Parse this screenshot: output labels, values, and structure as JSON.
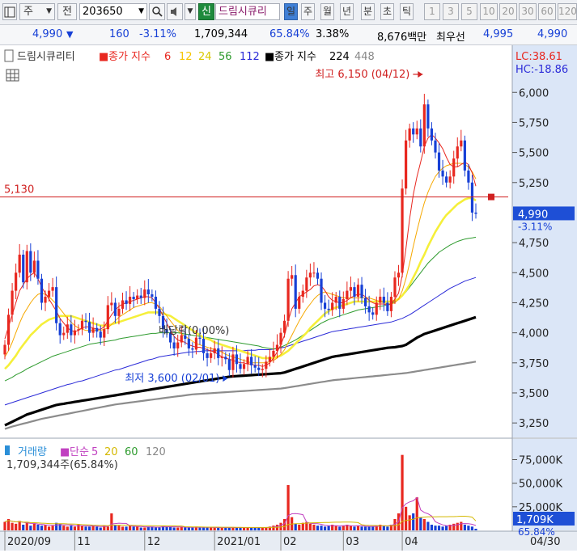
{
  "toolbar": {
    "menu_icon": "panel-icon",
    "market_label": "주",
    "prefix_label": "전",
    "code_value": "203650",
    "new_badge": "신",
    "stock_name": "드림시큐리",
    "periods": [
      "일",
      "주",
      "월",
      "년",
      "분",
      "초",
      "틱"
    ],
    "selected_period": "일",
    "numbers": [
      "1",
      "3",
      "5",
      "10",
      "20",
      "30",
      "60",
      "120"
    ]
  },
  "quote": {
    "price": "4,990",
    "change_arrow": "▼",
    "change": "160",
    "change_pct": "-3.11%",
    "volume": "1,709,344",
    "vol_ratio": "65.84%",
    "turnover": "3.38%",
    "amount": "8,676백만",
    "best_label": "최우선",
    "best_ask": "4,995",
    "best_bid": "4,990"
  },
  "chart_data": {
    "type": "candlestick",
    "legend": {
      "name": "드림시큐리티",
      "ma_prefix": "종가 지수",
      "ma_periods": [
        "6",
        "12",
        "24",
        "56",
        "112"
      ],
      "ma2_prefix": "종가 지수",
      "ma2_periods": [
        "224",
        "448"
      ],
      "colors": [
        "#e8271f",
        "#f6c400",
        "#f2f24a",
        "#2e9b2e",
        "#2b2bd8",
        "#000000",
        "#888888"
      ]
    },
    "lc_label": "LC:38.61",
    "hc_label": "HC:-18.86",
    "y_ticks": [
      "6,000",
      "5,750",
      "5,500",
      "5,250",
      "4,750",
      "4,500",
      "4,250",
      "4,000",
      "3,750",
      "3,500",
      "3,250"
    ],
    "y_tick_values": [
      6000,
      5750,
      5500,
      5250,
      4750,
      4500,
      4250,
      4000,
      3750,
      3500,
      3250
    ],
    "ylim": [
      3130,
      6190
    ],
    "ref_line_label": "5,130",
    "ref_line_value": 5130,
    "current_price_label": "4,990",
    "current_pct_label": "-3.11%",
    "current_price": 4990,
    "high_label": "최고 6,150 (04/12)",
    "low_label": "최저 3,600 (02/01)",
    "annotation_label": "배당락(0.00%)",
    "x_labels": [
      "2020/09",
      "11",
      "12",
      "2021/01",
      "02",
      "03",
      "04",
      "04/30"
    ],
    "x_label_index": [
      0,
      19,
      38,
      57,
      75,
      92,
      108,
      130
    ],
    "closes": [
      3900,
      4150,
      4350,
      4500,
      4650,
      4420,
      4680,
      4500,
      4600,
      4450,
      4250,
      4300,
      4350,
      4380,
      4080,
      3980,
      4000,
      4070,
      3980,
      4020,
      4030,
      4100,
      4090,
      4000,
      4040,
      4010,
      3960,
      4030,
      4230,
      4250,
      4140,
      4200,
      4270,
      4240,
      4300,
      4280,
      4310,
      4290,
      4360,
      4320,
      4300,
      4200,
      4140,
      4030,
      4000,
      3920,
      3870,
      3920,
      3980,
      3950,
      3870,
      3860,
      3960,
      3950,
      3830,
      3790,
      3830,
      3870,
      3790,
      3800,
      3780,
      3690,
      3820,
      3740,
      3700,
      3740,
      3800,
      3730,
      3710,
      3690,
      3700,
      3760,
      3800,
      3850,
      3900,
      4000,
      4100,
      4450,
      4480,
      4200,
      4300,
      4350,
      4460,
      4500,
      4500,
      4450,
      4250,
      4200,
      4190,
      4250,
      4300,
      4200,
      4280,
      4350,
      4380,
      4300,
      4400,
      4290,
      4220,
      4170,
      4150,
      4250,
      4300,
      4250,
      4180,
      4300,
      4460,
      4500,
      5200,
      5600,
      5700,
      5650,
      5700,
      5550,
      5900,
      5700,
      5600,
      5500,
      5350,
      5300,
      5250,
      5300,
      5450,
      5550,
      5600,
      5350,
      5250,
      5000,
      4990
    ],
    "ma6": [
      3950,
      4050,
      4150,
      4250,
      4350,
      4400,
      4450,
      4480,
      4500,
      4450,
      4380,
      4330,
      4280,
      4230,
      4180,
      4120,
      4080,
      4040,
      4020,
      4010,
      4020,
      4040,
      4050,
      4050,
      4040,
      4030,
      4030,
      4050,
      4100,
      4150,
      4190,
      4220,
      4240,
      4250,
      4260,
      4270,
      4280,
      4290,
      4300,
      4300,
      4290,
      4250,
      4200,
      4140,
      4080,
      4020,
      3970,
      3940,
      3930,
      3920,
      3900,
      3890,
      3880,
      3880,
      3870,
      3860,
      3850,
      3840,
      3820,
      3800,
      3790,
      3780,
      3770,
      3760,
      3750,
      3750,
      3740,
      3740,
      3730,
      3730,
      3720,
      3730,
      3750,
      3790,
      3840,
      3900,
      3980,
      4100,
      4200,
      4250,
      4300,
      4320,
      4340,
      4360,
      4390,
      4400,
      4390,
      4350,
      4300,
      4270,
      4260,
      4250,
      4250,
      4270,
      4290,
      4310,
      4320,
      4320,
      4300,
      4270,
      4250,
      4240,
      4240,
      4240,
      4230,
      4240,
      4280,
      4330,
      4480,
      4700,
      4950,
      5150,
      5300,
      5420,
      5550,
      5620,
      5650,
      5620,
      5580,
      5530,
      5460,
      5400,
      5380,
      5380,
      5400,
      5420,
      5400,
      5330,
      5220
    ],
    "ma12": [
      3800,
      3850,
      3920,
      4000,
      4080,
      4150,
      4200,
      4250,
      4290,
      4320,
      4330,
      4320,
      4300,
      4270,
      4240,
      4200,
      4160,
      4120,
      4090,
      4060,
      4040,
      4030,
      4020,
      4020,
      4020,
      4020,
      4020,
      4030,
      4040,
      4070,
      4100,
      4130,
      4150,
      4170,
      4190,
      4210,
      4220,
      4230,
      4240,
      4250,
      4250,
      4240,
      4220,
      4180,
      4140,
      4100,
      4060,
      4020,
      3990,
      3970,
      3950,
      3930,
      3910,
      3900,
      3890,
      3880,
      3870,
      3860,
      3850,
      3840,
      3820,
      3810,
      3800,
      3790,
      3780,
      3770,
      3760,
      3750,
      3750,
      3750,
      3750,
      3750,
      3760,
      3770,
      3790,
      3820,
      3860,
      3920,
      3980,
      4040,
      4100,
      4150,
      4200,
      4240,
      4280,
      4310,
      4330,
      4340,
      4330,
      4320,
      4310,
      4300,
      4290,
      4290,
      4290,
      4290,
      4290,
      4290,
      4290,
      4290,
      4280,
      4270,
      4260,
      4250,
      4240,
      4240,
      4250,
      4280,
      4350,
      4450,
      4580,
      4720,
      4850,
      4970,
      5080,
      5170,
      5240,
      5300,
      5340,
      5370,
      5390,
      5400,
      5410,
      5410,
      5410,
      5400,
      5380,
      5340,
      5280
    ],
    "ma24": [
      3700,
      3730,
      3770,
      3810,
      3860,
      3900,
      3940,
      3980,
      4010,
      4040,
      4070,
      4090,
      4110,
      4120,
      4130,
      4140,
      4140,
      4140,
      4140,
      4130,
      4120,
      4110,
      4100,
      4090,
      4080,
      4070,
      4060,
      4060,
      4060,
      4070,
      4080,
      4090,
      4100,
      4110,
      4120,
      4130,
      4140,
      4150,
      4160,
      4170,
      4170,
      4170,
      4170,
      4160,
      4150,
      4140,
      4120,
      4100,
      4080,
      4060,
      4040,
      4020,
      4000,
      3980,
      3960,
      3950,
      3940,
      3920,
      3910,
      3900,
      3890,
      3880,
      3870,
      3860,
      3850,
      3840,
      3830,
      3820,
      3810,
      3800,
      3790,
      3790,
      3790,
      3790,
      3800,
      3810,
      3830,
      3850,
      3880,
      3910,
      3940,
      3970,
      4000,
      4040,
      4070,
      4100,
      4130,
      4160,
      4180,
      4200,
      4210,
      4220,
      4230,
      4240,
      4250,
      4260,
      4260,
      4260,
      4260,
      4260,
      4260,
      4260,
      4260,
      4260,
      4260,
      4260,
      4270,
      4280,
      4310,
      4350,
      4400,
      4460,
      4520,
      4590,
      4650,
      4720,
      4780,
      4840,
      4890,
      4940,
      4980,
      5010,
      5040,
      5070,
      5090,
      5110,
      5120,
      5120,
      5100
    ],
    "ma56": [
      3600,
      3615,
      3630,
      3650,
      3665,
      3680,
      3700,
      3715,
      3730,
      3745,
      3760,
      3775,
      3790,
      3805,
      3815,
      3825,
      3835,
      3845,
      3855,
      3865,
      3875,
      3885,
      3895,
      3905,
      3910,
      3915,
      3920,
      3925,
      3930,
      3935,
      3940,
      3950,
      3955,
      3960,
      3965,
      3970,
      3975,
      3980,
      3985,
      3990,
      3995,
      3995,
      4000,
      4000,
      4000,
      4000,
      4000,
      4000,
      3995,
      3990,
      3985,
      3980,
      3975,
      3970,
      3965,
      3960,
      3955,
      3950,
      3945,
      3940,
      3935,
      3930,
      3925,
      3920,
      3915,
      3910,
      3905,
      3900,
      3895,
      3890,
      3880,
      3875,
      3870,
      3865,
      3870,
      3880,
      3895,
      3910,
      3925,
      3940,
      3960,
      3980,
      4000,
      4020,
      4040,
      4060,
      4080,
      4095,
      4110,
      4120,
      4130,
      4140,
      4150,
      4160,
      4170,
      4180,
      4190,
      4195,
      4200,
      4205,
      4210,
      4215,
      4220,
      4225,
      4235,
      4245,
      4260,
      4280,
      4310,
      4340,
      4380,
      4420,
      4460,
      4500,
      4540,
      4580,
      4610,
      4640,
      4670,
      4690,
      4710,
      4730,
      4745,
      4760,
      4770,
      4780,
      4785,
      4790,
      4795
    ],
    "ma112": [
      3400,
      3410,
      3420,
      3430,
      3440,
      3450,
      3460,
      3470,
      3480,
      3490,
      3500,
      3510,
      3520,
      3530,
      3540,
      3550,
      3560,
      3570,
      3575,
      3585,
      3595,
      3600,
      3610,
      3620,
      3630,
      3640,
      3650,
      3660,
      3670,
      3680,
      3690,
      3695,
      3705,
      3715,
      3725,
      3735,
      3745,
      3755,
      3765,
      3775,
      3780,
      3790,
      3800,
      3805,
      3810,
      3815,
      3820,
      3825,
      3830,
      3835,
      3840,
      3840,
      3845,
      3845,
      3850,
      3850,
      3850,
      3850,
      3850,
      3850,
      3850,
      3850,
      3850,
      3850,
      3850,
      3850,
      3855,
      3855,
      3855,
      3860,
      3860,
      3860,
      3860,
      3865,
      3870,
      3875,
      3880,
      3890,
      3900,
      3910,
      3920,
      3930,
      3940,
      3950,
      3960,
      3970,
      3980,
      3990,
      4000,
      4010,
      4015,
      4020,
      4025,
      4030,
      4035,
      4040,
      4045,
      4050,
      4055,
      4060,
      4065,
      4070,
      4075,
      4080,
      4085,
      4090,
      4100,
      4110,
      4120,
      4135,
      4150,
      4170,
      4190,
      4210,
      4230,
      4250,
      4270,
      4290,
      4310,
      4330,
      4350,
      4370,
      4385,
      4400,
      4415,
      4430,
      4440,
      4450,
      4460
    ],
    "ma224": [
      3230,
      3245,
      3260,
      3275,
      3290,
      3305,
      3320,
      3330,
      3340,
      3350,
      3360,
      3370,
      3380,
      3390,
      3400,
      3405,
      3410,
      3415,
      3420,
      3425,
      3430,
      3435,
      3440,
      3445,
      3450,
      3455,
      3460,
      3465,
      3470,
      3475,
      3480,
      3485,
      3490,
      3495,
      3500,
      3505,
      3510,
      3515,
      3520,
      3525,
      3530,
      3535,
      3540,
      3545,
      3550,
      3555,
      3560,
      3565,
      3570,
      3575,
      3580,
      3585,
      3590,
      3595,
      3600,
      3605,
      3610,
      3615,
      3620,
      3625,
      3630,
      3635,
      3638,
      3640,
      3642,
      3644,
      3646,
      3648,
      3650,
      3652,
      3654,
      3656,
      3658,
      3660,
      3662,
      3664,
      3670,
      3680,
      3690,
      3700,
      3710,
      3720,
      3730,
      3740,
      3750,
      3760,
      3770,
      3780,
      3790,
      3800,
      3805,
      3810,
      3815,
      3820,
      3825,
      3830,
      3835,
      3840,
      3845,
      3850,
      3855,
      3860,
      3865,
      3870,
      3875,
      3878,
      3880,
      3885,
      3890,
      3900,
      3920,
      3940,
      3960,
      3975,
      3990,
      4000,
      4010,
      4020,
      4030,
      4040,
      4050,
      4060,
      4070,
      4080,
      4090,
      4100,
      4110,
      4120,
      4130
    ],
    "ma448": [
      3200,
      3210,
      3220,
      3228,
      3236,
      3244,
      3252,
      3260,
      3268,
      3276,
      3284,
      3290,
      3296,
      3302,
      3308,
      3314,
      3320,
      3326,
      3332,
      3338,
      3344,
      3350,
      3356,
      3362,
      3368,
      3374,
      3380,
      3386,
      3392,
      3398,
      3404,
      3408,
      3412,
      3416,
      3420,
      3424,
      3428,
      3432,
      3436,
      3440,
      3444,
      3448,
      3452,
      3456,
      3460,
      3464,
      3468,
      3472,
      3476,
      3480,
      3484,
      3488,
      3490,
      3492,
      3494,
      3496,
      3498,
      3500,
      3502,
      3504,
      3506,
      3508,
      3510,
      3512,
      3514,
      3516,
      3518,
      3520,
      3522,
      3524,
      3526,
      3528,
      3530,
      3532,
      3534,
      3536,
      3540,
      3545,
      3550,
      3555,
      3560,
      3565,
      3570,
      3575,
      3580,
      3585,
      3590,
      3595,
      3600,
      3605,
      3608,
      3611,
      3614,
      3617,
      3620,
      3623,
      3626,
      3629,
      3632,
      3635,
      3638,
      3641,
      3644,
      3647,
      3650,
      3653,
      3656,
      3659,
      3662,
      3665,
      3670,
      3675,
      3680,
      3685,
      3690,
      3695,
      3700,
      3705,
      3710,
      3715,
      3720,
      3725,
      3730,
      3735,
      3740,
      3745,
      3750,
      3755,
      3760
    ],
    "volume_legend": {
      "name": "거래량",
      "ma_prefix": "단순",
      "ma_periods": [
        "5",
        "20",
        "60",
        "120"
      ],
      "detail": "1,709,344주(65.84%)"
    },
    "volume_ticks": [
      "75,000K",
      "50,000K",
      "25,000K"
    ],
    "volume_tick_values": [
      75000,
      50000,
      25000
    ],
    "volume_ylim": [
      0,
      90000
    ],
    "volume_current_label": "1,709K",
    "volume_pct_label": "65.84%",
    "volumes": [
      9000,
      12000,
      8000,
      7000,
      10000,
      6000,
      9000,
      5000,
      7000,
      6000,
      5000,
      6000,
      4000,
      5000,
      8000,
      7000,
      5000,
      4000,
      5000,
      4000,
      6000,
      5000,
      4000,
      4000,
      5000,
      4000,
      3000,
      5000,
      4000,
      18000,
      6000,
      5000,
      4000,
      4000,
      5000,
      4000,
      4000,
      3000,
      3000,
      4000,
      4000,
      3000,
      3000,
      5000,
      4000,
      4000,
      3000,
      3000,
      4000,
      3000,
      3000,
      3000,
      4000,
      3000,
      3000,
      3000,
      3000,
      3000,
      3000,
      3000,
      3000,
      3000,
      3000,
      3000,
      3000,
      3000,
      3000,
      3000,
      3000,
      3000,
      3000,
      3000,
      4000,
      5000,
      6000,
      8000,
      12000,
      48000,
      14000,
      7000,
      6000,
      8000,
      9000,
      7000,
      6000,
      5000,
      5000,
      4000,
      5000,
      6000,
      5000,
      4000,
      5000,
      6000,
      5000,
      4000,
      5000,
      4000,
      4000,
      4000,
      4000,
      5000,
      6000,
      5000,
      4000,
      6000,
      12000,
      18000,
      80000,
      25000,
      16000,
      18000,
      35000,
      14000,
      12000,
      9000,
      6000,
      5000,
      5000,
      4000,
      5000,
      6000,
      7000,
      8000,
      9000,
      6000,
      5000,
      4000,
      1709
    ]
  }
}
